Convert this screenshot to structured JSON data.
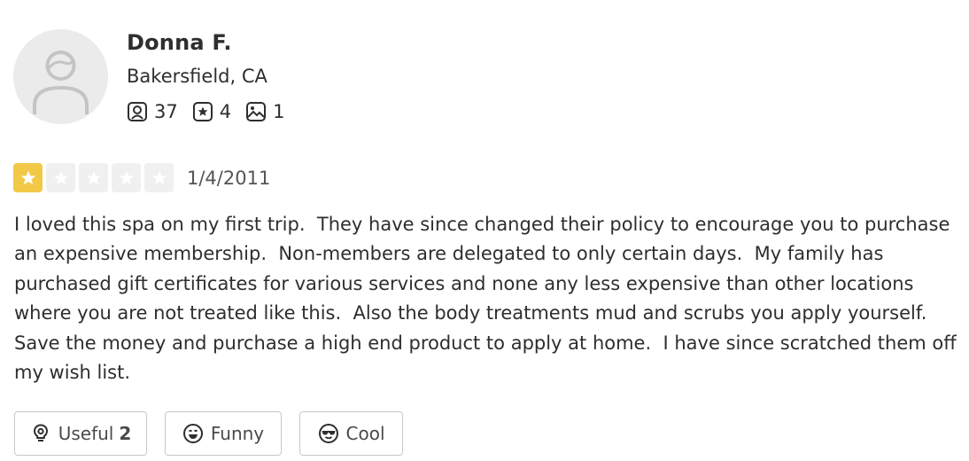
{
  "user": {
    "name": "Donna F.",
    "location": "Bakersfield, CA",
    "friends_count": "37",
    "reviews_count": "4",
    "photos_count": "1"
  },
  "review": {
    "rating": 1,
    "max_rating": 5,
    "date": "1/4/2011",
    "text": "I loved this spa on my first trip.  They have since changed their policy to encourage you to purchase an expensive membership.  Non-members are delegated to only certain days.  My family has purchased gift certificates for various services and none any less expensive than other locations where you are not treated like this.  Also the body treatments mud and scrubs you apply yourself.  Save the money and purchase a high end product to apply at home.  I have since scratched them off my wish list."
  },
  "actions": {
    "useful_label": "Useful",
    "useful_count": "2",
    "funny_label": "Funny",
    "cool_label": "Cool"
  },
  "colors": {
    "star_filled": "#f2c946",
    "star_empty": "#f0f0f0",
    "text": "#2d2e2f"
  }
}
